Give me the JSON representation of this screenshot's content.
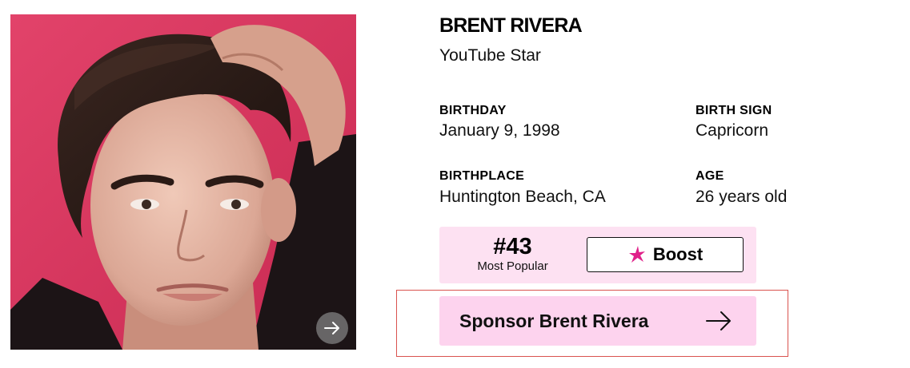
{
  "profile": {
    "name": "BRENT RIVERA",
    "profession": "YouTube Star"
  },
  "facts": {
    "birthday": {
      "label": "BIRTHDAY",
      "value": "January 9, 1998"
    },
    "birth_sign": {
      "label": "BIRTH SIGN",
      "value": "Capricorn"
    },
    "birthplace": {
      "label": "BIRTHPLACE",
      "value": "Huntington Beach, CA"
    },
    "age": {
      "label": "AGE",
      "value": "26 years old"
    }
  },
  "popularity": {
    "rank": "#43",
    "rank_label": "Most Popular",
    "boost_label": "Boost"
  },
  "sponsor": {
    "label": "Sponsor Brent Rivera"
  },
  "icons": {
    "boost": "star-icon",
    "sponsor": "arrow-right-icon",
    "photo_next": "arrow-right-icon"
  },
  "colors": {
    "photo_background": "#d6365d",
    "rank_panel": "#fde1f2",
    "sponsor_button": "#fdd3ee",
    "boost_star": "#e0218a",
    "highlight_frame": "#d9534f"
  }
}
